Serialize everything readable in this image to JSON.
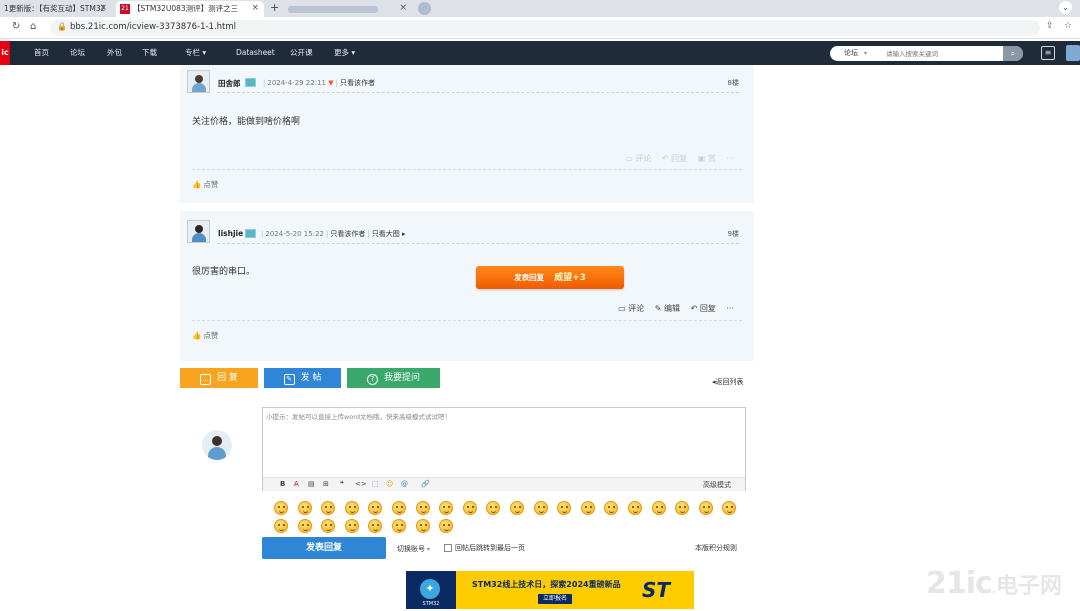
{
  "browser": {
    "tabs": [
      {
        "label": "1更新版：【有奖互动】STM32",
        "active": false
      },
      {
        "label": "【STM32U083测评】测评之三",
        "active": true,
        "favicon": "21"
      },
      {
        "label": "",
        "active": false,
        "blurred": true
      }
    ],
    "url": "bbs.21ic.com/icview-3373876-1-1.html"
  },
  "sitenav": {
    "logo": "ic",
    "items": [
      "首页",
      "论坛",
      "外包",
      "下载",
      "专栏 ▾",
      "Datasheet",
      "公开课",
      "更多 ▾"
    ],
    "search_category": "论坛",
    "search_placeholder": "请输入搜索关键词"
  },
  "posts": [
    {
      "author": "田舍郎",
      "date": "2024-4-29 22:11",
      "only_author": "只看该作者",
      "floor": "8楼",
      "content": "关注价格，能做到啥价格啊",
      "actions": [
        "评论",
        "回复",
        "赏",
        "···"
      ],
      "like": "点赞"
    },
    {
      "author": "lishjie",
      "date": "2024-5-20 15:22",
      "only_author": "只看该作者",
      "big_image": "只看大图",
      "floor": "9楼",
      "content": "很厉害的串口。",
      "actions": [
        "评论",
        "编辑",
        "回复",
        "···"
      ],
      "like": "点赞"
    }
  ],
  "float_promo": {
    "label": "发表回复",
    "bonus": "威望+3"
  },
  "action_buttons": [
    {
      "label": "回 复",
      "color": "#f7a521",
      "icon": "comment-icon"
    },
    {
      "label": "发 帖",
      "color": "#2f86d6",
      "icon": "edit-icon"
    },
    {
      "label": "我要提问",
      "color": "#3aa76d",
      "icon": "question-icon"
    }
  ],
  "back_to_list": "返回列表",
  "editor": {
    "hint": "小提示：发帖可以直接上传word文档哦，快来高级模式试试吧！",
    "toolbar": [
      "B",
      "A",
      "▤",
      "⊞",
      "❝",
      "<>",
      "⬚",
      "☺",
      "@",
      "🔗"
    ],
    "advanced": "高级模式"
  },
  "emoji_count": 28,
  "submit_label": "发表回复",
  "switch_account": "切换账号",
  "jump_last_label": "回帖后跳转到最后一页",
  "rules_link": "本版积分规则",
  "banner": {
    "title": "STM32线上技术日，探索2024重磅新品",
    "cta": "立即报名",
    "brand": "ST",
    "logo_text": "STM32"
  },
  "watermark": {
    "main": "21ic",
    "cn": "电子网"
  }
}
